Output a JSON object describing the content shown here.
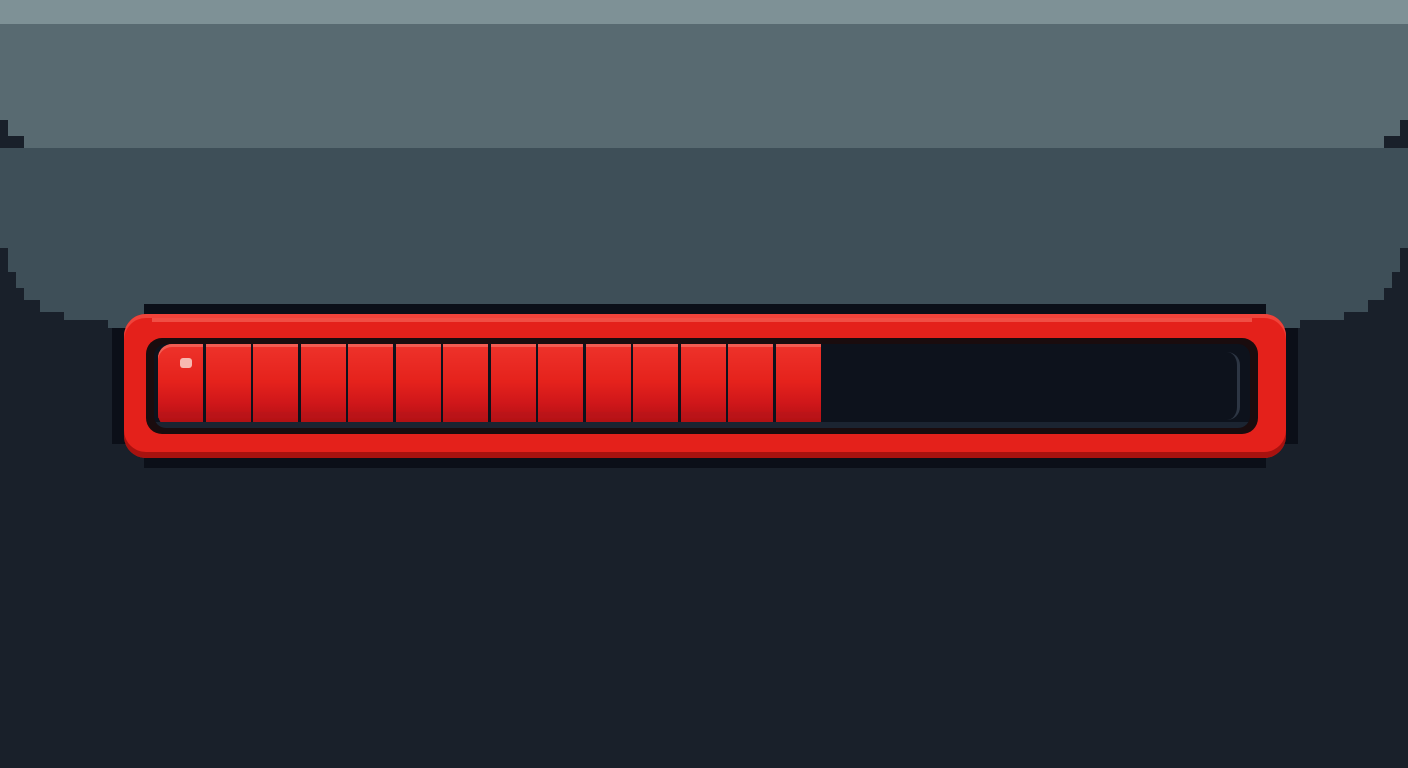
{
  "health_bar": {
    "fill_fraction": 0.61,
    "segments_filled": 14,
    "fill_color": "#e4211b",
    "frame_color": "#e4211b",
    "empty_color": "#0d121c"
  },
  "colors": {
    "background": "#19202a",
    "upper_panel": "#586a71",
    "middle_panel": "#3e4f58",
    "top_band": "#7e9196"
  }
}
